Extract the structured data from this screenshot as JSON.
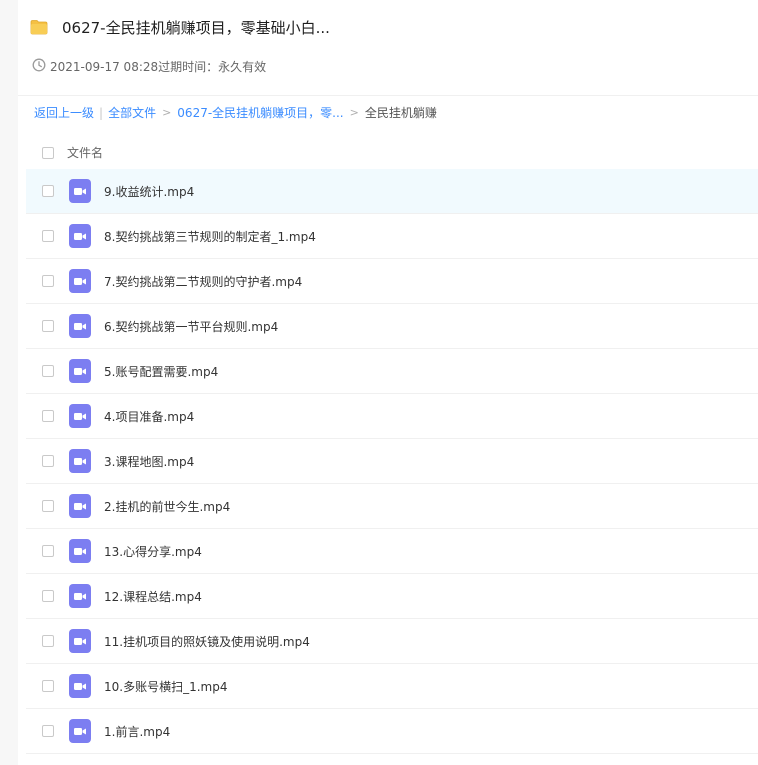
{
  "share": {
    "title": "0627-全民挂机躺赚项目，零基础小白...",
    "meta": "2021-09-17 08:28过期时间：永久有效"
  },
  "breadcrumb": {
    "back": "返回上一级",
    "all_files": "全部文件",
    "parent": "0627-全民挂机躺赚项目，零...",
    "current": "全民挂机躺赚"
  },
  "list": {
    "column_name": "文件名",
    "files": [
      {
        "name": "9.收益统计.mp4"
      },
      {
        "name": "8.契约挑战第三节规则的制定者_1.mp4"
      },
      {
        "name": "7.契约挑战第二节规则的守护者.mp4"
      },
      {
        "name": "6.契约挑战第一节平台规则.mp4"
      },
      {
        "name": "5.账号配置需要.mp4"
      },
      {
        "name": "4.项目准备.mp4"
      },
      {
        "name": "3.课程地图.mp4"
      },
      {
        "name": "2.挂机的前世今生.mp4"
      },
      {
        "name": "13.心得分享.mp4"
      },
      {
        "name": "12.课程总结.mp4"
      },
      {
        "name": "11.挂机项目的照妖镜及使用说明.mp4"
      },
      {
        "name": "10.多账号横扫_1.mp4"
      },
      {
        "name": "1.前言.mp4"
      }
    ]
  },
  "colors": {
    "link": "#3b8cff",
    "video_icon": "#7c7ef1",
    "folder": "#f5c043",
    "row_highlight": "#f1fafe"
  }
}
